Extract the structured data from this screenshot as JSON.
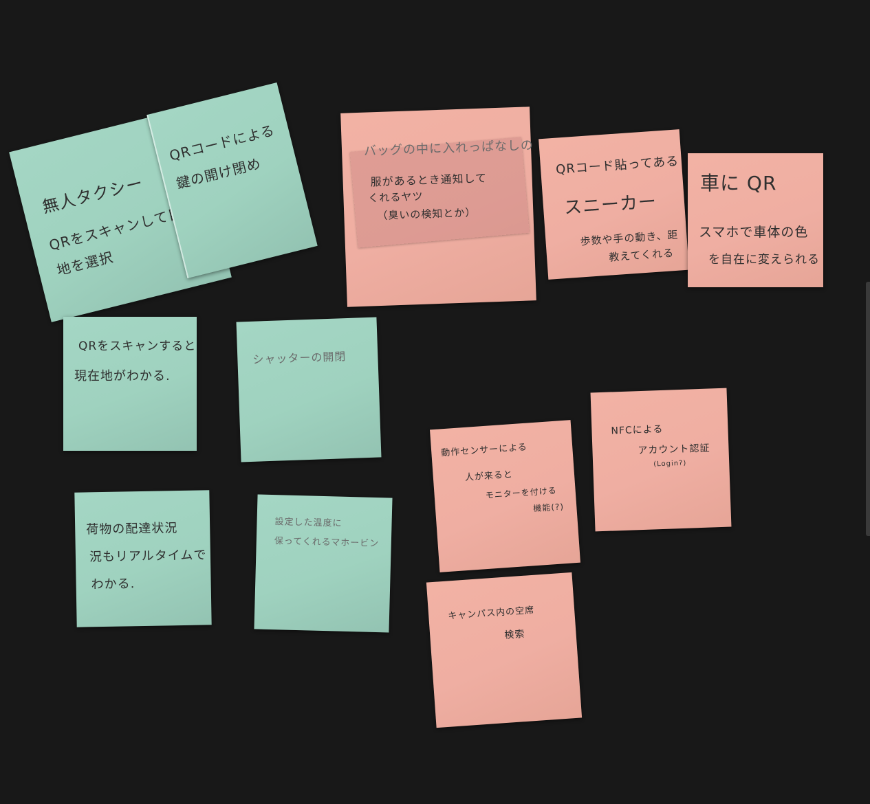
{
  "board": {
    "notes": [
      {
        "id": "taxi",
        "lines": [
          "無人タクシー",
          "QRをスキャンして目的地",
          "地を選択"
        ]
      },
      {
        "id": "key",
        "lines": [
          "QRコードによる",
          "鍵の開け閉め"
        ]
      },
      {
        "id": "bag",
        "lines": [
          "バッグの中に入れっぱなしの",
          "服があるとき通知して",
          "くれるヤツ",
          "（臭いの検知とか）"
        ]
      },
      {
        "id": "sneaker",
        "lines": [
          "QRコード貼ってある",
          "スニーカー",
          "歩数や手の動き、距",
          "教えてくれる"
        ]
      },
      {
        "id": "car",
        "lines": [
          "車に QR",
          "スマホで車体の色",
          "を自在に変えられる"
        ]
      },
      {
        "id": "location",
        "lines": [
          "QRをスキャンすると",
          "現在地がわかる."
        ]
      },
      {
        "id": "shutter",
        "lines": [
          "シャッターの開閉"
        ]
      },
      {
        "id": "delivery",
        "lines": [
          "荷物の配達状況",
          "況もリアルタイムで",
          "わかる."
        ]
      },
      {
        "id": "thermos",
        "lines": [
          "設定した温度に",
          "保ってくれるマホービン"
        ]
      },
      {
        "id": "motion",
        "lines": [
          "動作センサーによる",
          "人が来ると",
          "モニターを付ける",
          "機能(?)"
        ]
      },
      {
        "id": "nfc",
        "lines": [
          "NFCによる",
          "アカウント認証",
          "(Login?)"
        ]
      },
      {
        "id": "campus",
        "lines": [
          "キャンパス内の空席",
          "検索"
        ]
      }
    ]
  }
}
